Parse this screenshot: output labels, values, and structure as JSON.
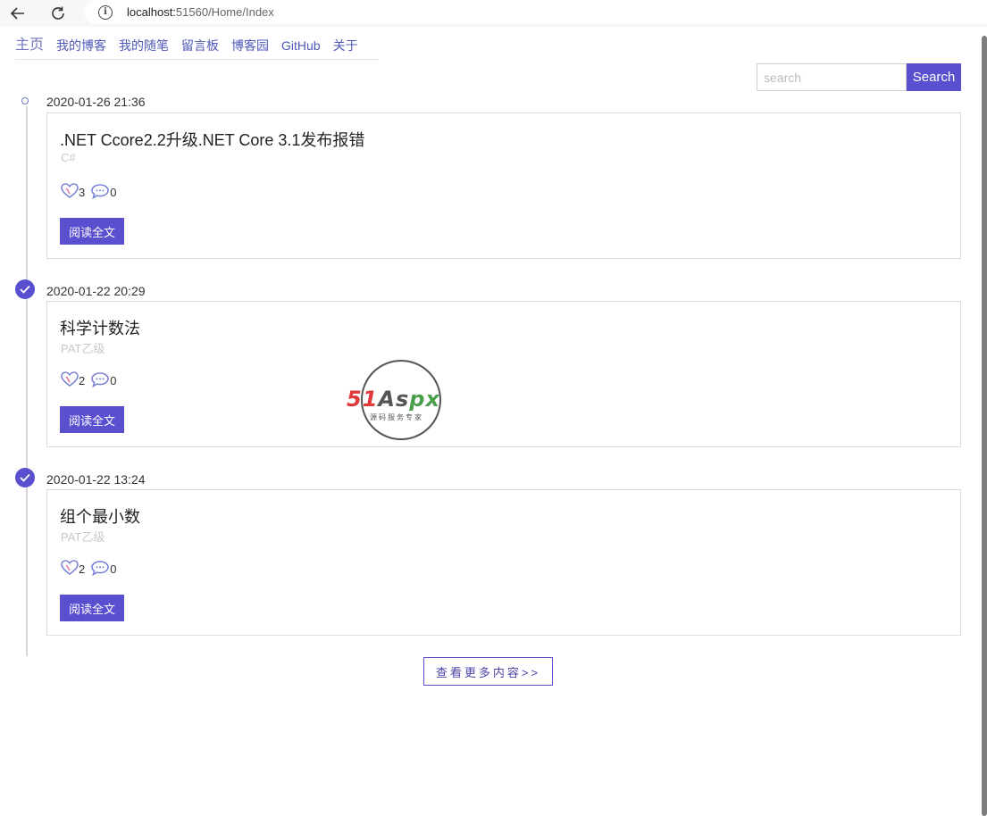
{
  "browser": {
    "url_host": "localhost:",
    "url_rest": "51560/Home/Index"
  },
  "nav": {
    "items": [
      "主页",
      "我的博客",
      "我的随笔",
      "留言板",
      "博客园",
      "GitHub",
      "关于"
    ]
  },
  "search": {
    "placeholder": "search",
    "button_label": "Search"
  },
  "posts": [
    {
      "date": "2020-01-26 21:36",
      "title": ".NET Ccore2.2升级.NET Core 3.1发布报错",
      "tag": "C#",
      "likes": "3",
      "comments": "0",
      "read_label": "阅读全文"
    },
    {
      "date": "2020-01-22 20:29",
      "title": "科学计数法",
      "tag": "PAT乙级",
      "likes": "2",
      "comments": "0",
      "read_label": "阅读全文"
    },
    {
      "date": "2020-01-22 13:24",
      "title": "组个最小数",
      "tag": "PAT乙级",
      "likes": "2",
      "comments": "0",
      "read_label": "阅读全文"
    }
  ],
  "more_label": "查看更多内容>>",
  "watermark": {
    "logo_a": "51",
    "logo_b": "As",
    "logo_c": "px",
    "subtitle": "源码服务专家"
  },
  "colors": {
    "accent": "#5a4fcf",
    "nav_link": "#4e58b8"
  }
}
